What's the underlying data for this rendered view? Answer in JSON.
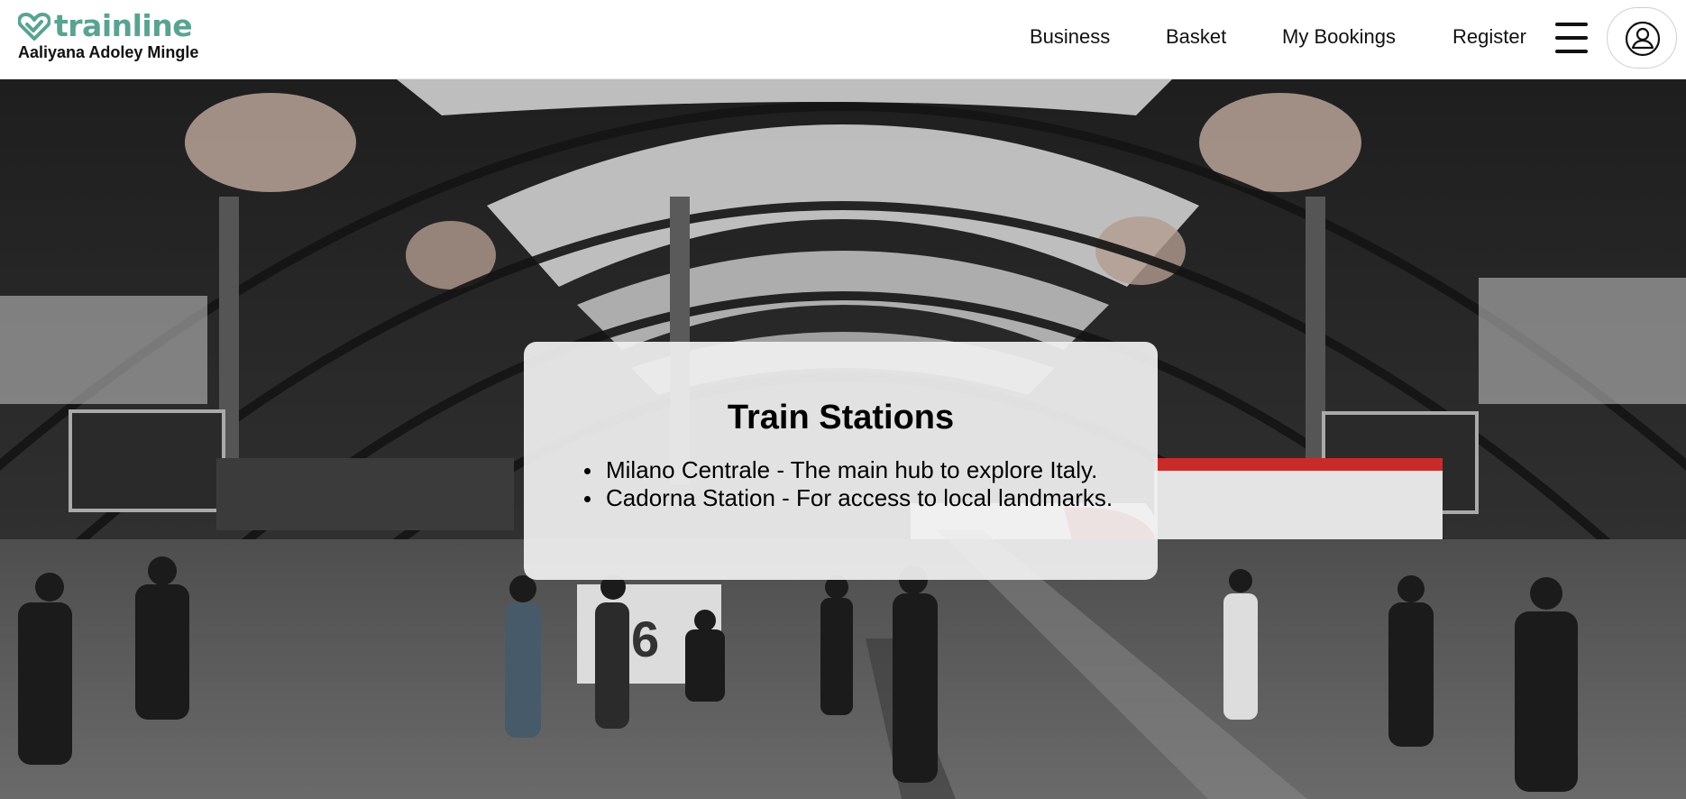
{
  "brand": {
    "logo_text": "trainline",
    "user_name": "Aaliyana Adoley Mingle",
    "logo_color": "#5aa392"
  },
  "nav": {
    "items": [
      {
        "label": "Business"
      },
      {
        "label": "Basket"
      },
      {
        "label": "My Bookings"
      },
      {
        "label": "Register"
      }
    ],
    "menu_icon": "hamburger-menu-icon",
    "account_icon": "user-account-icon"
  },
  "hero": {
    "background": "train station interior photo"
  },
  "card": {
    "title": "Train Stations",
    "stations": [
      {
        "text": "Milano Centrale - The main hub to explore Italy."
      },
      {
        "text": "Cadorna Station - For access to local landmarks."
      }
    ]
  }
}
